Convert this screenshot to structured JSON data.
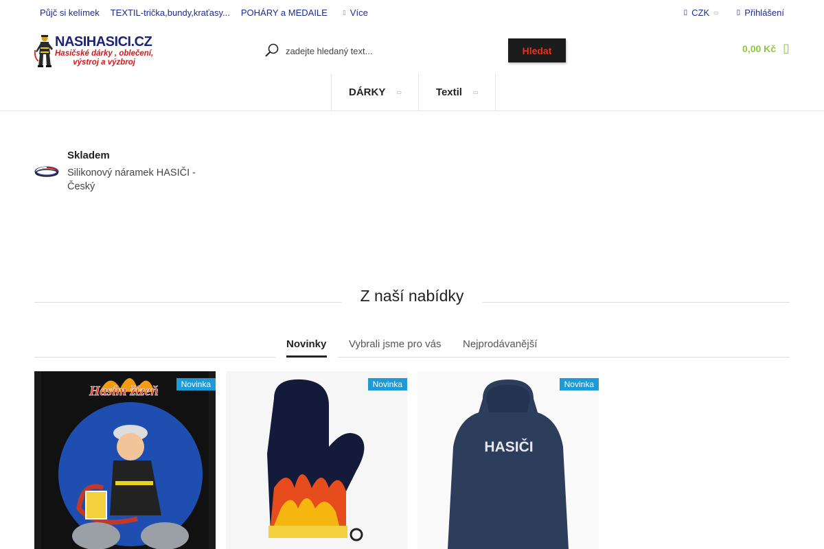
{
  "top_links": [
    "Půjč si kelímek",
    "TEXTIL-trička,bundy,kraťasy...",
    "POHÁRY a MEDAILE"
  ],
  "top_more": "Více",
  "currency": "CZK",
  "login": "Přihlášení",
  "logo": {
    "brand": "NASIHASICI.CZ",
    "tagline_1": "Hasičské dárky , oblečení,",
    "tagline_2": "výstroj a výzbroj"
  },
  "search": {
    "placeholder": "zadejte hledaný text...",
    "button": "Hledat"
  },
  "cart": {
    "total": "0,00 Kč",
    "icon": "shopping-bag-icon"
  },
  "nav": [
    "DÁRKY",
    "Textil"
  ],
  "stock_product": {
    "status": "Skladem",
    "name": "Silikonový náramek HASIČI - Český"
  },
  "offer": {
    "title": "Z naší nabídky",
    "tabs": [
      "Novinky",
      "Vybrali jsme pro vás",
      "Nejprodávanější"
    ],
    "active_tab": "Novinky"
  },
  "products": [
    {
      "badge": "Novinka",
      "image": "Hasím žízeň",
      "print": ""
    },
    {
      "badge": "Novinka",
      "image": "oven mitt with flames",
      "print": ""
    },
    {
      "badge": "Novinka",
      "image": "navy jacket",
      "print": "HASIČI"
    }
  ],
  "colors": {
    "link": "#1c2b8f",
    "cart": "#8cc63f",
    "badge": "#1e9bd7",
    "search_button_text": "#e8331c"
  }
}
